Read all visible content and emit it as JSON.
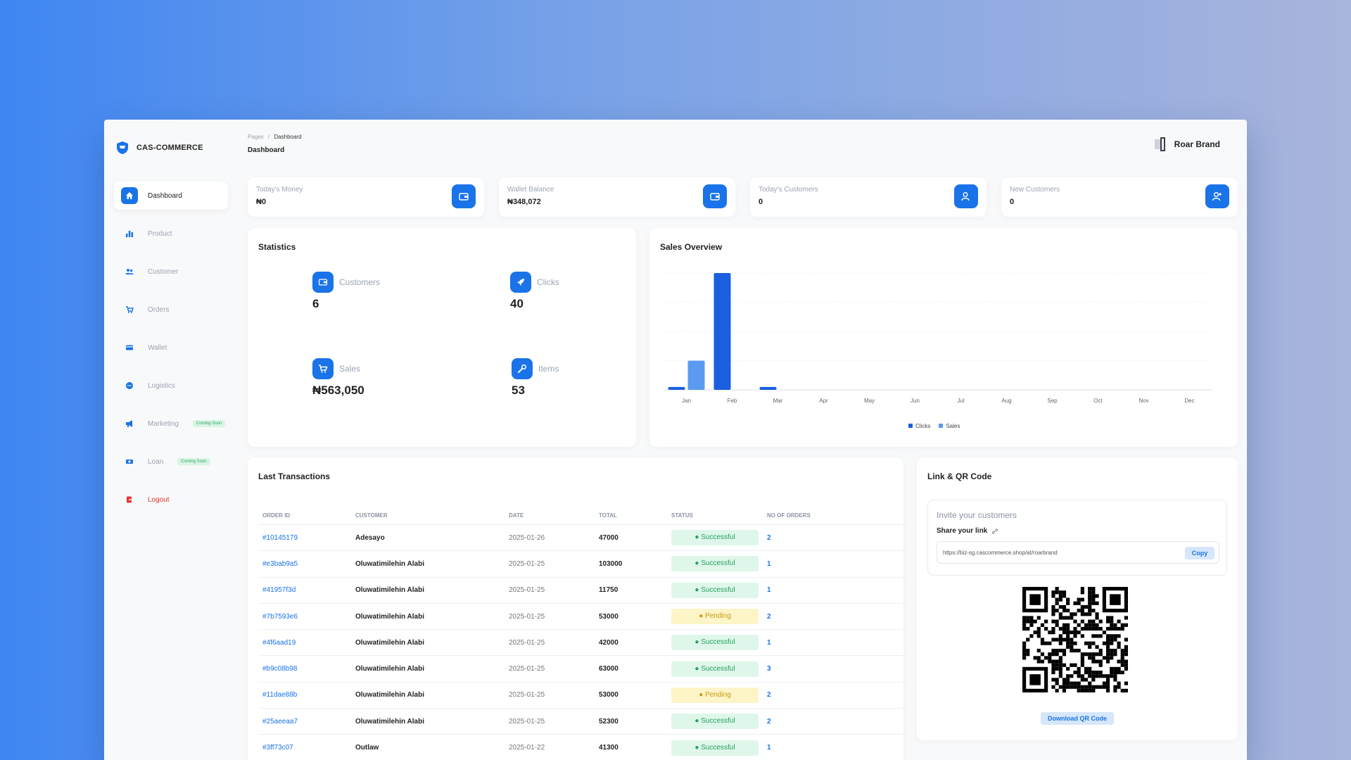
{
  "brand": {
    "name": "CAS-COMMERCE"
  },
  "breadcrumb": {
    "parent": "Pages",
    "separator": "/",
    "current": "Dashboard"
  },
  "page_title": "Dashboard",
  "user": {
    "name": "Roar Brand"
  },
  "sidebar": {
    "items": [
      {
        "label": "Dashboard",
        "icon": "home-icon"
      },
      {
        "label": "Product",
        "icon": "bar-chart-icon"
      },
      {
        "label": "Customer",
        "icon": "users-icon"
      },
      {
        "label": "Orders",
        "icon": "cart-icon"
      },
      {
        "label": "Wallet",
        "icon": "card-icon"
      },
      {
        "label": "Logistics",
        "icon": "truck-icon"
      },
      {
        "label": "Marketing",
        "icon": "megaphone-icon",
        "badge": "Coming Soon"
      },
      {
        "label": "Loan",
        "icon": "money-icon",
        "badge": "Coming Soon"
      },
      {
        "label": "Logout",
        "icon": "logout-icon"
      }
    ]
  },
  "stats": [
    {
      "label": "Today's Money",
      "value": "₦0",
      "icon": "wallet-icon"
    },
    {
      "label": "Wallet Balance",
      "value": "₦348,072",
      "icon": "wallet-icon"
    },
    {
      "label": "Today's Customers",
      "value": "0",
      "icon": "user-icon"
    },
    {
      "label": "New Customers",
      "value": "0",
      "icon": "add-user-icon"
    }
  ],
  "statistics": {
    "title": "Statistics",
    "metrics": [
      {
        "label": "Customers",
        "value": "6",
        "icon": "wallet-icon"
      },
      {
        "label": "Clicks",
        "value": "40",
        "icon": "rocket-icon"
      },
      {
        "label": "Sales",
        "value": "₦563,050",
        "icon": "cart-icon"
      },
      {
        "label": "Items",
        "value": "53",
        "icon": "wrench-icon"
      }
    ]
  },
  "sales_overview": {
    "title": "Sales Overview"
  },
  "chart_data": {
    "type": "bar",
    "categories": [
      "Jan",
      "Feb",
      "Mar",
      "Apr",
      "May",
      "Jun",
      "Jul",
      "Aug",
      "Sep",
      "Oct",
      "Nov",
      "Dec"
    ],
    "series": [
      {
        "name": "Clicks",
        "color": "#1a5fe0",
        "values": [
          1,
          40,
          1,
          0,
          0,
          0,
          0,
          0,
          0,
          0,
          0,
          0
        ]
      },
      {
        "name": "Sales",
        "color": "#5a9bf0",
        "values": [
          10,
          0,
          0,
          0,
          0,
          0,
          0,
          0,
          0,
          0,
          0,
          0
        ]
      }
    ],
    "ylim": [
      0,
      40
    ],
    "grid": true,
    "legend": "bottom"
  },
  "transactions": {
    "title": "Last Transactions",
    "columns": [
      "ORDER ID",
      "CUSTOMER",
      "DATE",
      "TOTAL",
      "STATUS",
      "NO OF ORDERS"
    ],
    "rows": [
      {
        "id": "#10145179",
        "customer": "Adesayo",
        "date": "2025-01-26",
        "total": "47000",
        "status": "Successful",
        "orders": "2"
      },
      {
        "id": "#e3bab9a5",
        "customer": "Oluwatimilehin Alabi",
        "date": "2025-01-25",
        "total": "103000",
        "status": "Successful",
        "orders": "1"
      },
      {
        "id": "#41957f3d",
        "customer": "Oluwatimilehin Alabi",
        "date": "2025-01-25",
        "total": "11750",
        "status": "Successful",
        "orders": "1"
      },
      {
        "id": "#7b7593e6",
        "customer": "Oluwatimilehin Alabi",
        "date": "2025-01-25",
        "total": "53000",
        "status": "Pending",
        "orders": "2"
      },
      {
        "id": "#4f6aad19",
        "customer": "Oluwatimilehin Alabi",
        "date": "2025-01-25",
        "total": "42000",
        "status": "Successful",
        "orders": "1"
      },
      {
        "id": "#b9c08b98",
        "customer": "Oluwatimilehin Alabi",
        "date": "2025-01-25",
        "total": "63000",
        "status": "Successful",
        "orders": "3"
      },
      {
        "id": "#11dae88b",
        "customer": "Oluwatimilehin Alabi",
        "date": "2025-01-25",
        "total": "53000",
        "status": "Pending",
        "orders": "2"
      },
      {
        "id": "#25aeeaa7",
        "customer": "Oluwatimilehin Alabi",
        "date": "2025-01-25",
        "total": "52300",
        "status": "Successful",
        "orders": "2"
      },
      {
        "id": "#3ff73c07",
        "customer": "Outlaw",
        "date": "2025-01-22",
        "total": "41300",
        "status": "Successful",
        "orders": "1"
      }
    ]
  },
  "qr": {
    "title": "Link & QR Code",
    "invite_title": "Invite your customers",
    "share_label": "Share your link",
    "link": "https://biz-sg.cascommerce.shop/at/roarbrand",
    "copy_label": "Copy",
    "download_label": "Download QR Code"
  },
  "colors": {
    "accent": "#1a73e8",
    "success_bg": "#dff7ea",
    "pending_bg": "#fdf4c7",
    "logout": "#e53935"
  }
}
